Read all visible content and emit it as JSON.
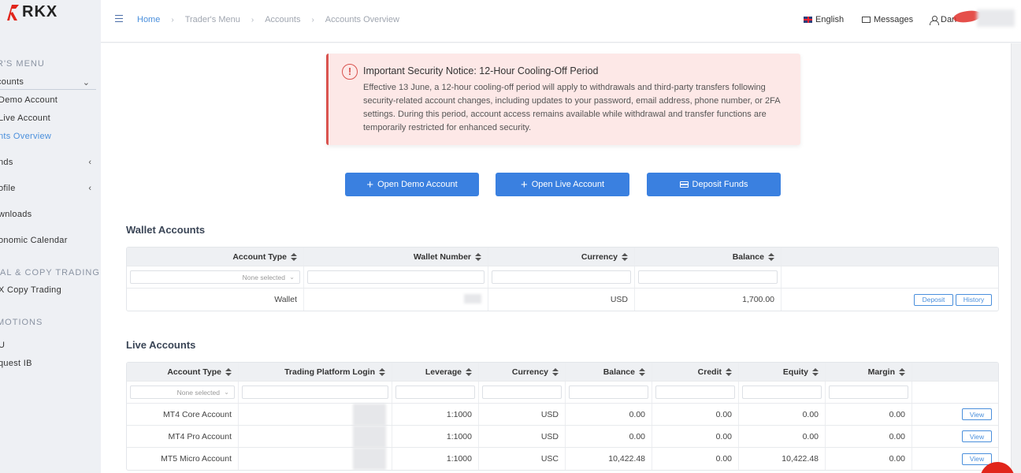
{
  "brand": {
    "logo_text": "RKX",
    "logo_color": "#e1251b"
  },
  "sidebar": {
    "sections": [
      "R'S MENU",
      "IAL & COPY TRADING",
      "MOTIONS"
    ],
    "items": [
      {
        "label": "counts"
      },
      {
        "label": "Demo Account"
      },
      {
        "label": "Live Account"
      },
      {
        "label": "nts Overview"
      },
      {
        "label": "nds"
      },
      {
        "label": "ofile"
      },
      {
        "label": "wnloads"
      },
      {
        "label": "onomic Calendar"
      },
      {
        "label": "X Copy Trading"
      },
      {
        "label": "U"
      },
      {
        "label": "quest IB"
      }
    ]
  },
  "topbar": {
    "breadcrumbs": [
      "Home",
      "Trader's Menu",
      "Accounts",
      "Accounts Overview"
    ],
    "language": "English",
    "messages": "Messages",
    "user": "Dan"
  },
  "notice": {
    "icon": "exclamation-circle-icon",
    "title": "Important Security Notice: 12-Hour Cooling-Off Period",
    "body": "Effective 13 June, a 12-hour cooling-off period will apply to withdrawals and third-party transfers following security-related account changes, including updates to your password, email address, phone number, or 2FA settings. During this period, account access remains available while withdrawal and transfer functions are temporarily restricted for enhanced security."
  },
  "actions": {
    "open_demo": "Open Demo Account",
    "open_live": "Open Live Account",
    "deposit": "Deposit Funds",
    "accent": "#3a80e0"
  },
  "wallet": {
    "title": "Wallet Accounts",
    "headers": [
      "Account Type",
      "Wallet Number",
      "Currency",
      "Balance"
    ],
    "filter_placeholder": "None selected",
    "rows": [
      {
        "type": "Wallet",
        "currency": "USD",
        "balance": "1,700.00",
        "btn_deposit": "Deposit",
        "btn_history": "History"
      }
    ]
  },
  "live": {
    "title": "Live Accounts",
    "headers": [
      "Account Type",
      "Trading Platform Login",
      "Leverage",
      "Currency",
      "Balance",
      "Credit",
      "Equity",
      "Margin"
    ],
    "filter_placeholder": "None selected",
    "view_label": "View",
    "rows": [
      {
        "type": "MT4 Core Account",
        "leverage": "1:1000",
        "currency": "USD",
        "balance": "0.00",
        "credit": "0.00",
        "equity": "0.00",
        "margin": "0.00"
      },
      {
        "type": "MT4 Pro Account",
        "leverage": "1:1000",
        "currency": "USD",
        "balance": "0.00",
        "credit": "0.00",
        "equity": "0.00",
        "margin": "0.00"
      },
      {
        "type": "MT5 Micro Account",
        "leverage": "1:1000",
        "currency": "USC",
        "balance": "10,422.48",
        "credit": "0.00",
        "equity": "10,422.48",
        "margin": "0.00"
      }
    ]
  }
}
